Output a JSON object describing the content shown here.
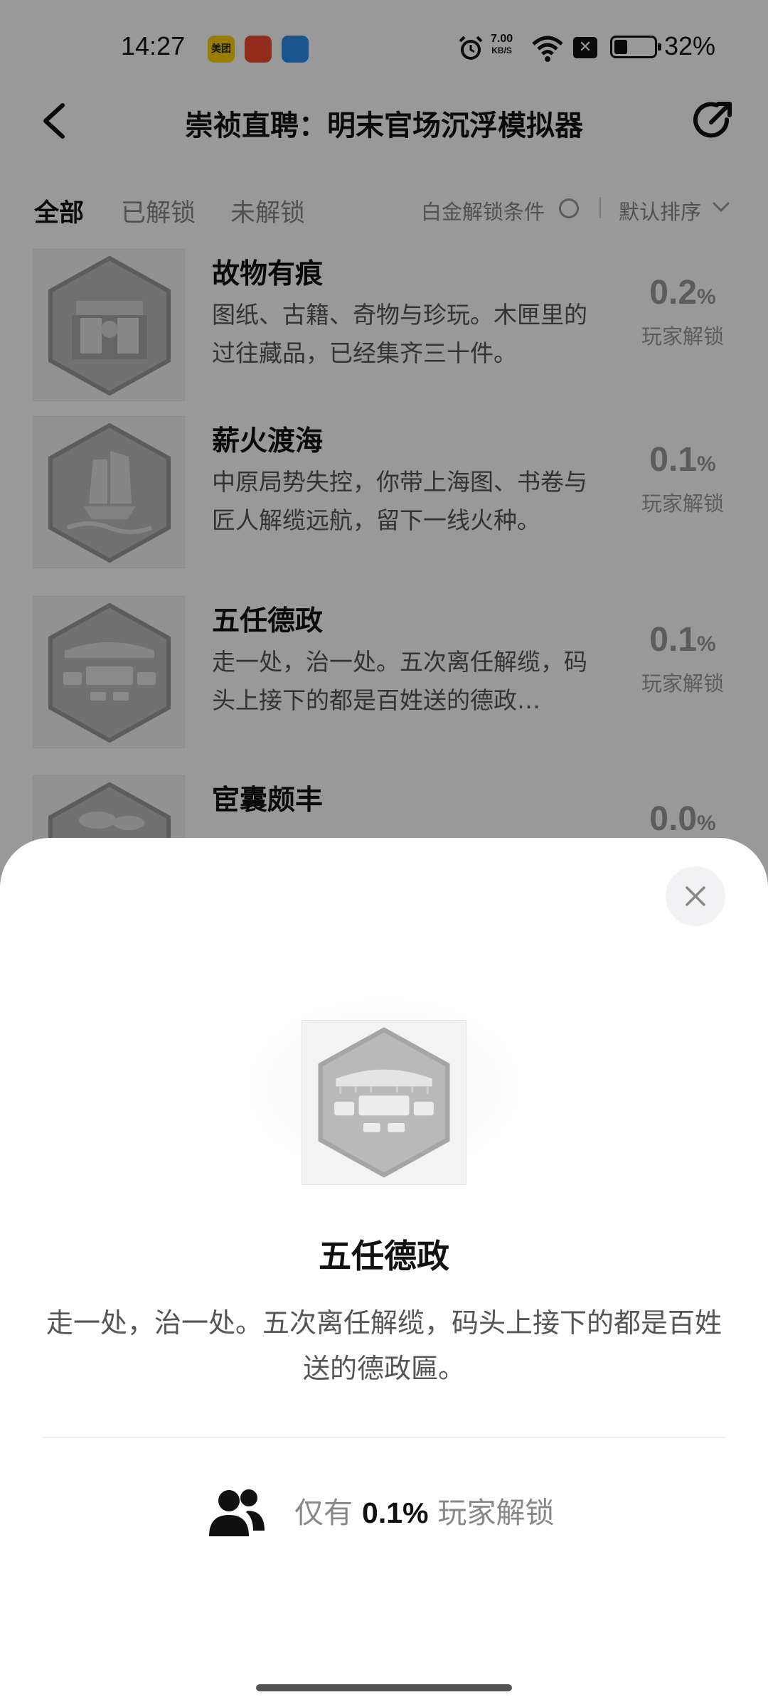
{
  "status_bar": {
    "time": "14:27",
    "apps": [
      "美团"
    ],
    "net_speed_value": "7.00",
    "net_speed_unit": "KB/S",
    "battery_text": "32%",
    "battery_level": 0.32
  },
  "header": {
    "title": "崇祯直聘：明末官场沉浮模拟器",
    "back_icon": "chevron-left-icon",
    "share_icon": "share-icon"
  },
  "tabs": {
    "items": [
      "全部",
      "已解锁",
      "未解锁"
    ],
    "active_index": 0,
    "platinum_label": "白金解锁条件",
    "sort_label": "默认排序"
  },
  "achievements": [
    {
      "title": "故物有痕",
      "desc": "图纸、古籍、奇物与珍玩。木匣里的过往藏品，已经集齐三十件。",
      "pct": "0.2",
      "pct_unit": "%",
      "pct_label": "玩家解锁"
    },
    {
      "title": "薪火渡海",
      "desc": "中原局势失控，你带上海图、书卷与匠人解缆远航，留下一线火种。",
      "pct": "0.1",
      "pct_unit": "%",
      "pct_label": "玩家解锁"
    },
    {
      "title": "五任德政",
      "desc": "走一处，治一处。五次离任解缆，码头上接下的都是百姓送的德政…",
      "pct": "0.1",
      "pct_unit": "%",
      "pct_label": "玩家解锁"
    },
    {
      "title": "宦囊颇丰",
      "desc": "",
      "pct": "0.0",
      "pct_unit": "%",
      "pct_label": ""
    }
  ],
  "detail_sheet": {
    "title": "五任德政",
    "description": "走一处，治一处。五次离任解缆，码头上接下的都是百姓送的德政匾。",
    "rate_prefix": "仅有",
    "rate_value": "0.1%",
    "rate_suffix": "玩家解锁",
    "close_icon": "close-icon",
    "players_icon": "users-icon"
  }
}
